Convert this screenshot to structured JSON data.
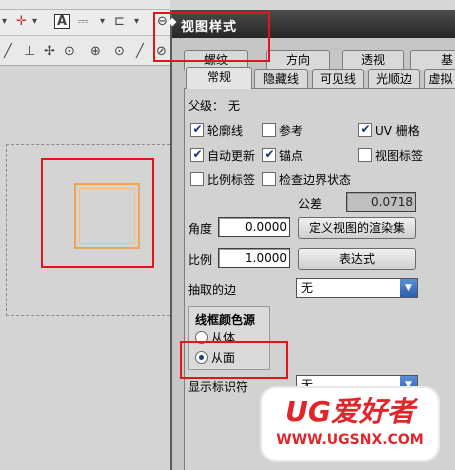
{
  "dialog": {
    "title": "视图样式",
    "tabs_row1": [
      "螺纹",
      "方向",
      "透视",
      "基"
    ],
    "tabs_row2": [
      "常规",
      "隐藏线",
      "可见线",
      "光顺边",
      "虚拟"
    ],
    "parent_label": "父级：",
    "parent_value": "无",
    "checkboxes": [
      {
        "label": "轮廓线",
        "checked": true
      },
      {
        "label": "参考",
        "checked": false
      },
      {
        "label": "UV 栅格",
        "checked": true
      },
      {
        "label": "自动更新",
        "checked": true
      },
      {
        "label": "锚点",
        "checked": true
      },
      {
        "label": "视图标签",
        "checked": false
      },
      {
        "label": "比例标签",
        "checked": false
      },
      {
        "label": "检查边界状态",
        "checked": false
      }
    ],
    "tolerance_label": "公差",
    "tolerance_value": "0.0718",
    "angle_label": "角度",
    "angle_value": "0.0000",
    "define_render_set_button": "定义视图的渲染集",
    "scale_label": "比例",
    "scale_value": "1.0000",
    "expression_button": "表达式",
    "extracted_edges_label": "抽取的边",
    "extracted_edges_value": "无",
    "wireframe_color_group": {
      "title": "线框颜色源",
      "options": [
        {
          "label": "从体",
          "selected": false
        },
        {
          "label": "从面",
          "selected": true
        }
      ]
    },
    "display_marker_label": "显示标识符",
    "display_marker_value": "无"
  },
  "watermark": {
    "logo_text": "UG爱好者",
    "url": "WWW.UGSNX.COM"
  },
  "colors": {
    "highlight_red": "#e3141c",
    "orange_view_border": "#f0a64a",
    "titlebar": "#333333",
    "checkbox_tick": "#16307a",
    "combo_arrow": "#2c5eae",
    "watermark_red": "#e1262b"
  },
  "icons": [
    "dropdown-arrow-icon",
    "text-tool-icon",
    "line-tool-icon",
    "snap-point-icon",
    "crosshair-icon",
    "zoom-icon"
  ]
}
